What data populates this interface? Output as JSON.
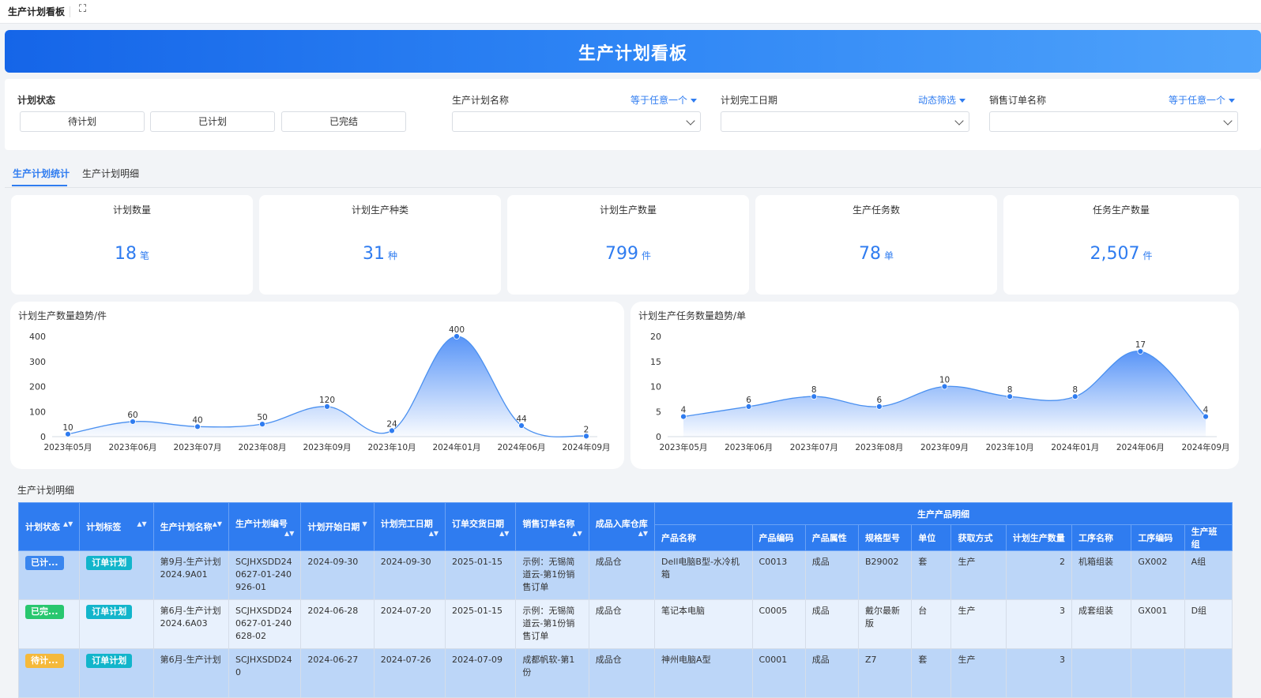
{
  "topbar": {
    "title": "生产计划看板",
    "fullscreen_icon": "fullscreen-icon"
  },
  "banner": {
    "title": "生产计划看板"
  },
  "filters": {
    "status": {
      "label": "计划状态",
      "options": [
        "待计划",
        "已计划",
        "已完结"
      ]
    },
    "plan_name": {
      "label": "生产计划名称",
      "mode": "等于任意一个"
    },
    "finish_date": {
      "label": "计划完工日期",
      "mode": "动态筛选"
    },
    "order_name": {
      "label": "销售订单名称",
      "mode": "等于任意一个"
    }
  },
  "tabs": [
    {
      "label": "生产计划统计",
      "active": true
    },
    {
      "label": "生产计划明细",
      "active": false
    }
  ],
  "kpis": [
    {
      "label": "计划数量",
      "value": "18",
      "unit": "笔"
    },
    {
      "label": "计划生产种类",
      "value": "31",
      "unit": "种"
    },
    {
      "label": "计划生产数量",
      "value": "799",
      "unit": "件"
    },
    {
      "label": "生产任务数",
      "value": "78",
      "unit": "单"
    },
    {
      "label": "任务生产数量",
      "value": "2,507",
      "unit": "件"
    }
  ],
  "colors": {
    "accent": "#2f7cf0",
    "tag_done": "#28c76f",
    "tag_pending": "#f5b93b",
    "tag_planned": "#3a86ef",
    "tag_label": "#12b5cb"
  },
  "chart_data": [
    {
      "type": "area",
      "title": "计划生产数量趋势/件",
      "categories": [
        "2023年05月",
        "2023年06月",
        "2023年07月",
        "2023年08月",
        "2023年09月",
        "2023年10月",
        "2024年01月",
        "2024年06月",
        "2024年09月"
      ],
      "values": [
        10,
        60,
        40,
        50,
        120,
        24,
        400,
        44,
        2
      ],
      "ylim": [
        0,
        400
      ],
      "yticks": [
        0,
        100,
        200,
        300,
        400
      ]
    },
    {
      "type": "area",
      "title": "计划生产任务数量趋势/单",
      "categories": [
        "2023年05月",
        "2023年06月",
        "2023年07月",
        "2023年08月",
        "2023年09月",
        "2023年10月",
        "2024年01月",
        "2024年06月",
        "2024年09月"
      ],
      "values": [
        4,
        6,
        8,
        6,
        10,
        8,
        8,
        17,
        4
      ],
      "ylim": [
        0,
        20
      ],
      "yticks": [
        0,
        5,
        10,
        15,
        20
      ]
    }
  ],
  "table": {
    "title": "生产计划明细",
    "group_header": "生产产品明细",
    "columns": [
      "计划状态",
      "计划标签",
      "生产计划名称",
      "生产计划编号",
      "计划开始日期",
      "计划完工日期",
      "订单交货日期",
      "销售订单名称",
      "成品入库仓库"
    ],
    "sub_columns": [
      "产品名称",
      "产品编码",
      "产品属性",
      "规格型号",
      "单位",
      "获取方式",
      "计划生产数量",
      "工序名称",
      "工序编码",
      "生产班组"
    ],
    "rows": [
      {
        "status": "已计...",
        "status_kind": "planned",
        "tag": "订单计划",
        "name": "第9月-生产计划2024.9A01",
        "code": "SCJHXSDD240627-01-240926-01",
        "start": "2024-09-30",
        "finish": "2024-09-30",
        "delivery": "2025-01-15",
        "order": "示例：无锡简道云-第1份销售订单",
        "warehouse": "成品仓",
        "product": "Dell电脑B型-水冷机箱",
        "pcode": "C0013",
        "attr": "成品",
        "spec": "B29002",
        "unit": "套",
        "method": "生产",
        "qty": "2",
        "proc": "机箱组装",
        "proc_code": "GX002",
        "team": "A组"
      },
      {
        "status": "已完...",
        "status_kind": "done",
        "tag": "订单计划",
        "name": "第6月-生产计划2024.6A03",
        "code": "SCJHXSDD240627-01-240628-02",
        "start": "2024-06-28",
        "finish": "2024-07-20",
        "delivery": "2025-01-15",
        "order": "示例：无锡简道云-第1份销售订单",
        "warehouse": "成品仓",
        "product": "笔记本电脑",
        "pcode": "C0005",
        "attr": "成品",
        "spec": "戴尔最新版",
        "unit": "台",
        "method": "生产",
        "qty": "3",
        "proc": "成套组装",
        "proc_code": "GX001",
        "team": "D组"
      },
      {
        "status": "待计...",
        "status_kind": "pending",
        "tag": "订单计划",
        "name": "第6月-生产计划",
        "code": "SCJHXSDD240",
        "start": "2024-06-27",
        "finish": "2024-07-26",
        "delivery": "2024-07-09",
        "order": "成都帆软-第1份",
        "warehouse": "成品仓",
        "product": "神州电脑A型",
        "pcode": "C0001",
        "attr": "成品",
        "spec": "Z7",
        "unit": "套",
        "method": "生产",
        "qty": "3",
        "proc": "",
        "proc_code": "",
        "team": ""
      }
    ]
  }
}
